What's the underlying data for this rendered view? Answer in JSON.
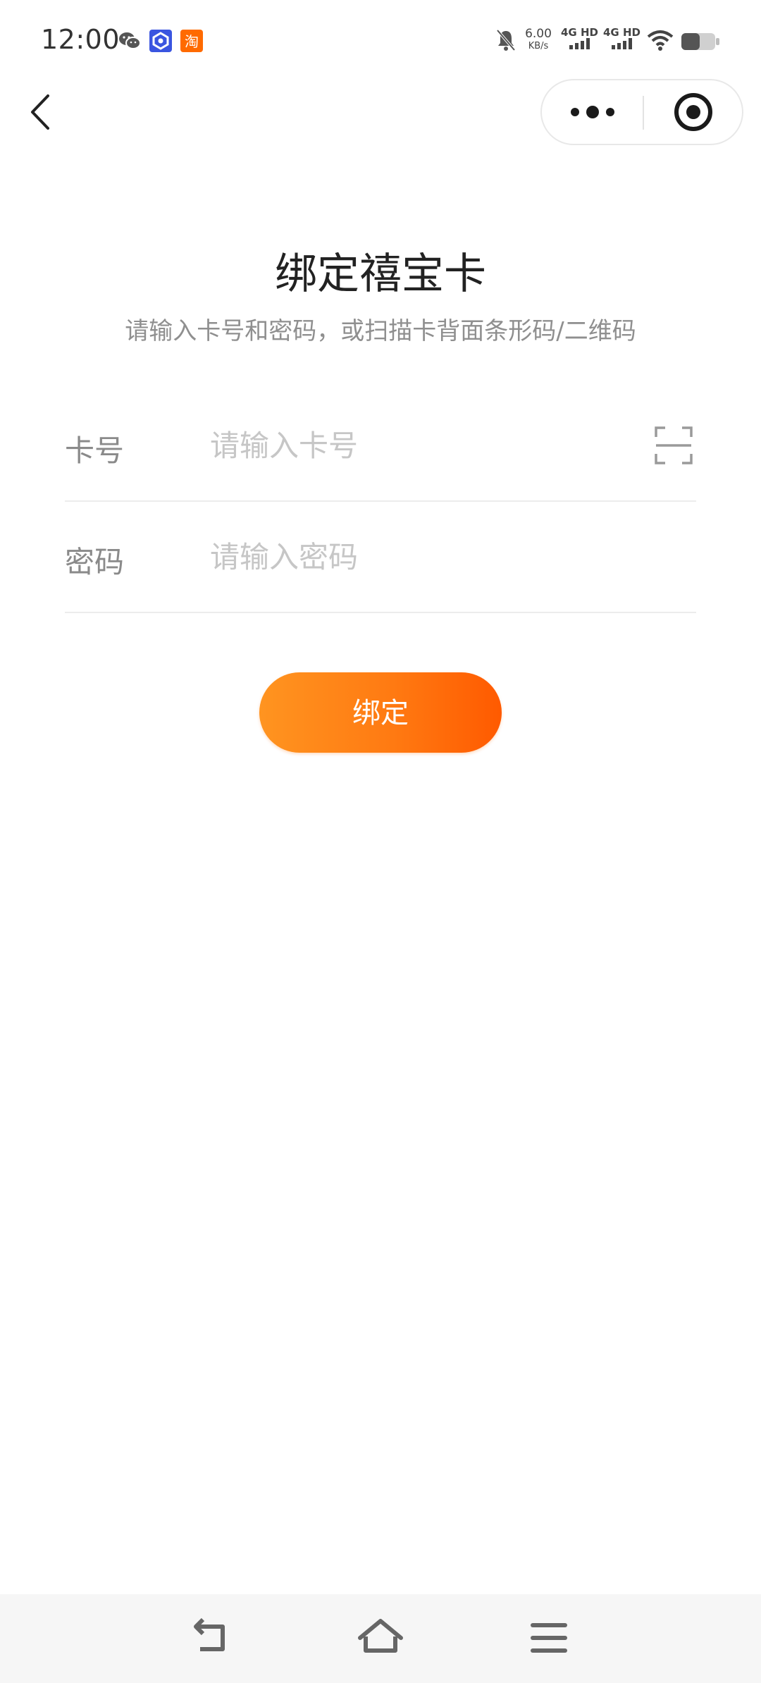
{
  "status_bar": {
    "time": "12:00",
    "net_speed_value": "6.00",
    "net_speed_unit": "KB/s",
    "signal1_label": "4G HD",
    "signal2_label": "4G HD",
    "icons": [
      "wechat-icon",
      "app-icon",
      "taobao-icon",
      "mute-bell-icon",
      "signal-icon",
      "wifi-icon",
      "battery-icon"
    ],
    "taobao_glyph": "淘"
  },
  "titlebar": {
    "back_icon": "chevron-left-icon",
    "more_icon": "more-dots-icon",
    "close_icon": "target-circle-icon"
  },
  "page": {
    "title": "绑定禧宝卡",
    "subtitle": "请输入卡号和密码，或扫描卡背面条形码/二维码"
  },
  "form": {
    "card": {
      "label": "卡号",
      "value": "",
      "placeholder": "请输入卡号",
      "scan_icon": "scan-icon"
    },
    "password": {
      "label": "密码",
      "value": "",
      "placeholder": "请输入密码"
    },
    "submit_label": "绑定"
  },
  "colors": {
    "accent_start": "#ff9420",
    "accent_end": "#ff5a00",
    "label": "#8a8a8a",
    "placeholder": "#c6c6c6"
  },
  "nav": {
    "icons": [
      "back-nav-icon",
      "home-nav-icon",
      "menu-nav-icon"
    ]
  }
}
